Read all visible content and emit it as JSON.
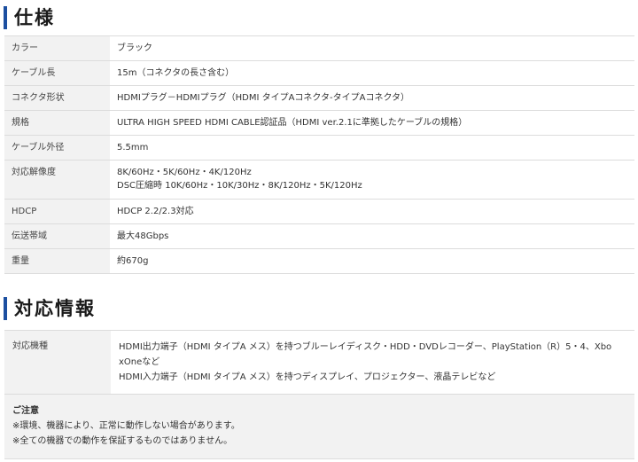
{
  "spec": {
    "title": "仕様",
    "rows": [
      {
        "label": "カラー",
        "value": "ブラック"
      },
      {
        "label": "ケーブル長",
        "value": "15m（コネクタの長さ含む）"
      },
      {
        "label": "コネクタ形状",
        "value": "HDMIプラグ－HDMIプラグ（HDMI タイプAコネクタ-タイプAコネクタ）"
      },
      {
        "label": "規格",
        "value": "ULTRA HIGH SPEED HDMI CABLE認証品（HDMI ver.2.1に準拠したケーブルの規格）"
      },
      {
        "label": "ケーブル外径",
        "value": "5.5mm"
      },
      {
        "label": "対応解像度",
        "value": "8K/60Hz・5K/60Hz・4K/120Hz",
        "value2": "DSC圧縮時 10K/60Hz・10K/30Hz・8K/120Hz・5K/120Hz"
      },
      {
        "label": "HDCP",
        "value": "HDCP 2.2/2.3対応"
      },
      {
        "label": "伝送帯域",
        "value": "最大48Gbps"
      },
      {
        "label": "重量",
        "value": "約670g"
      }
    ]
  },
  "compat": {
    "title": "対応情報",
    "label": "対応機種",
    "line1": "HDMI出力端子（HDMI タイプA メス）を持つブルーレイディスク・HDD・DVDレコーダー、PlayStation（R）5・4、Xbo",
    "line2": "xOneなど",
    "line3": "HDMI入力端子（HDMI タイプA メス）を持つディスプレイ、プロジェクター、液晶テレビなど"
  },
  "caution": {
    "title": "ご注意",
    "line1": "※環境、機器により、正常に動作しない場合があります。",
    "line2": "※全ての機器での動作を保証するものではありません。"
  },
  "colors": {
    "accent": "#1c4fa0",
    "label_bg": "#f2f2f2",
    "border": "#dcdcdc"
  }
}
